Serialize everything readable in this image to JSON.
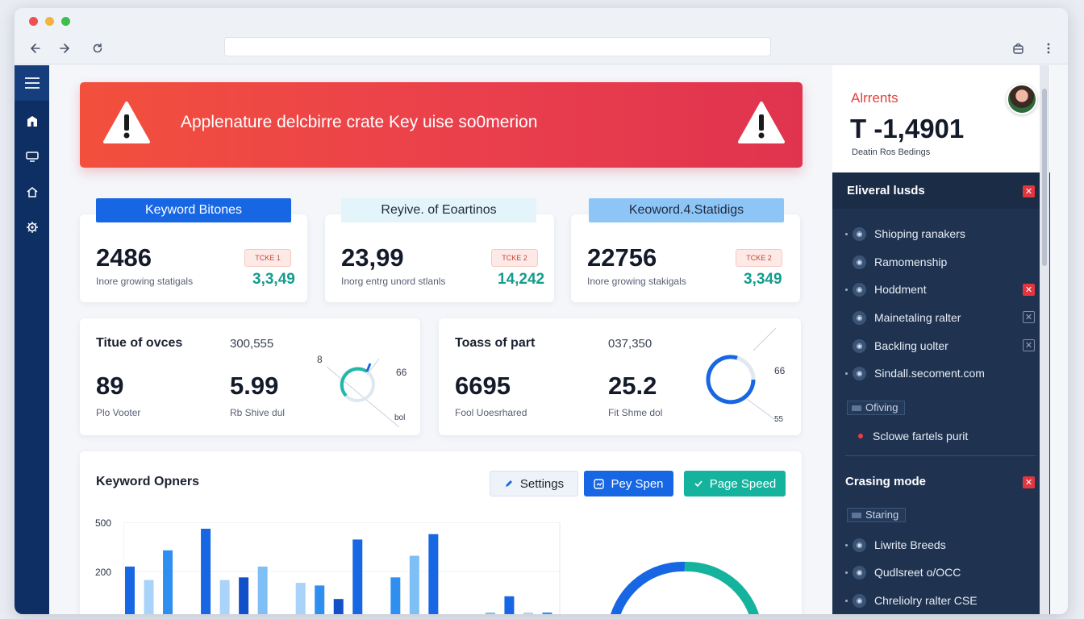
{
  "alert": {
    "message": "Applenature delcbirre crate Key uise so0merion"
  },
  "kpi_cards": [
    {
      "tag": "Keyword Bitones",
      "value": "2486",
      "badge": "TCKE 1",
      "caption": "Inore growing statigals",
      "delta": "3,3,49"
    },
    {
      "tag": "Reyive. of Eoartinos",
      "value": "23,99",
      "badge": "TCKE 2",
      "caption": "Inorg entrg unord stlanls",
      "delta": "14,242"
    },
    {
      "tag": "Keoword.4.Statidigs",
      "value": "22756",
      "badge": "TCKE 2",
      "caption": "Inore growing stakigals",
      "delta": "3,349"
    }
  ],
  "stat_cards": [
    {
      "title": "Titue of ovces",
      "sub": "300,555",
      "big1": "89",
      "small1": "Plo Vooter",
      "big2": "5.99",
      "small2": "Rb Shive dul",
      "gauge_labels": [
        "8",
        "66",
        "bol"
      ]
    },
    {
      "title": "Toass of part",
      "sub": "037,350",
      "big1": "6695",
      "small1": "Fool Uoesrhared",
      "big2": "25.2",
      "small2": "Fit Shme dol",
      "gauge_labels": [
        "66",
        "55"
      ]
    }
  ],
  "chart_panel": {
    "title": "Keyword Opners",
    "buttons": {
      "settings": "Settings",
      "pay_span": "Pey Spen",
      "page_speed": "Page Speed"
    }
  },
  "chart_data": {
    "type": "bar",
    "ylabels": [
      "500",
      "200"
    ],
    "series": [
      {
        "values": [
          200,
          150,
          260,
          0,
          340,
          150,
          0,
          200,
          20,
          140,
          130,
          0,
          300,
          0,
          160,
          240,
          320,
          0,
          0,
          30,
          90,
          30,
          30
        ]
      },
      {
        "values": [
          0,
          0,
          0,
          0,
          0,
          0,
          160,
          0,
          0,
          0,
          0,
          80,
          0,
          0,
          0,
          0,
          0,
          0,
          0,
          0,
          0,
          0,
          0
        ]
      }
    ]
  },
  "colors": {
    "accent_blue": "#1766e3",
    "teal": "#15b39e",
    "alert_red": "#ea3f4c",
    "sidebar": "#0e2f64",
    "panel_dark": "#1f3350"
  },
  "right_panel": {
    "header_title": "Alrrents",
    "header_value": "T -1,4901",
    "header_sub": "Deatin Ros Bedings",
    "section1_title": "Eliveral lusds",
    "section1_items": [
      "Shioping ranakers",
      "Ramomenship",
      "Hoddment",
      "Mainetaling ralter",
      "Backling uolter",
      "Sindall.secoment.com"
    ],
    "subsection1_label": "Ofiving",
    "subsection1_item": "Sclowe fartels purit",
    "section2_title": "Crasing mode",
    "subsection2_label": "Staring",
    "section2_items": [
      "Liwrite Breeds",
      "Qudlsreet o/OCC",
      "Chreliolry ralter CSE"
    ]
  }
}
